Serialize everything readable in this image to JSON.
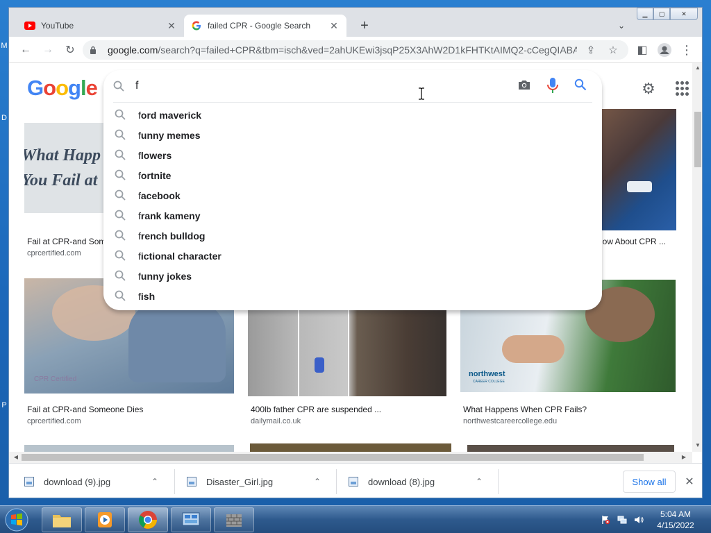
{
  "desktop": {
    "edge_letters": [
      "M",
      "D",
      "P"
    ]
  },
  "window": {
    "minimize_glyph": "▁",
    "maximize_glyph": "▢",
    "close_glyph": "✕"
  },
  "tabs": [
    {
      "title": "YouTube",
      "icon": "youtube-icon",
      "active": false,
      "close_glyph": "✕"
    },
    {
      "title": "failed CPR - Google Search",
      "icon": "google-g-icon",
      "active": true,
      "close_glyph": "✕"
    }
  ],
  "tabstrip": {
    "new_tab_glyph": "+",
    "tab_search_glyph": "⌄"
  },
  "toolbar": {
    "back_glyph": "←",
    "forward_glyph": "→",
    "reload_glyph": "↻",
    "url_host": "google.com",
    "url_rest": "/search?q=failed+CPR&tbm=isch&ved=2ahUKEwi3jsqP25X3AhW2D1kFHTKtAIMQ2-cCegQIABA...",
    "share_glyph": "⇪",
    "star_glyph": "☆",
    "sidepanel_glyph": "◧",
    "menu_glyph": "⋮"
  },
  "google": {
    "logo_letters": [
      {
        "ch": "G",
        "color": "#4285F4"
      },
      {
        "ch": "o",
        "color": "#EA4335"
      },
      {
        "ch": "o",
        "color": "#FBBC05"
      },
      {
        "ch": "g",
        "color": "#4285F4"
      },
      {
        "ch": "l",
        "color": "#34A853"
      },
      {
        "ch": "e",
        "color": "#EA4335"
      }
    ],
    "gear_glyph": "⚙"
  },
  "search": {
    "value": "f",
    "suggestions": [
      {
        "typed": "f",
        "rest": "ord maverick"
      },
      {
        "typed": "f",
        "rest": "unny memes"
      },
      {
        "typed": "f",
        "rest": "lowers"
      },
      {
        "typed": "f",
        "rest": "ortnite"
      },
      {
        "typed": "f",
        "rest": "acebook"
      },
      {
        "typed": "f",
        "rest": "rank kameny"
      },
      {
        "typed": "f",
        "rest": "rench bulldog"
      },
      {
        "typed": "f",
        "rest": "ictional character"
      },
      {
        "typed": "f",
        "rest": "unny jokes"
      },
      {
        "typed": "f",
        "rest": "ish"
      }
    ]
  },
  "results": {
    "row1": [
      {
        "title": "Fail at CPR-and Som",
        "source": "cprcertified.com",
        "overlay_text_1": "What Happ",
        "overlay_text_2": "You Fail at"
      },
      {
        "title": "now About CPR ...",
        "source": ""
      }
    ],
    "row2": [
      {
        "title": "Fail at CPR-and Someone Dies",
        "source": "cprcertified.com",
        "watermark": "CPR Certified"
      },
      {
        "title": "400lb father CPR are suspended ...",
        "source": "dailymail.co.uk"
      },
      {
        "title": "What Happens When CPR Fails?",
        "source": "northwestcareercollege.edu",
        "overlay_text_1": "northwest",
        "overlay_text_2": "CAREER COLLEGE"
      }
    ]
  },
  "downloads": {
    "items": [
      {
        "name": "download (9).jpg"
      },
      {
        "name": "Disaster_Girl.jpg"
      },
      {
        "name": "download (8).jpg"
      }
    ],
    "show_all": "Show all",
    "close_glyph": "✕",
    "chevron_glyph": "⌃"
  },
  "taskbar": {
    "apps": [
      "file-explorer-icon",
      "media-player-icon",
      "chrome-icon",
      "control-panel-icon",
      "firewall-icon"
    ],
    "time": "5:04 AM",
    "date": "4/15/2022"
  },
  "colors": {
    "google_blue": "#4285F4",
    "link_blue": "#1a73e8",
    "mic_red": "#EA4335"
  }
}
